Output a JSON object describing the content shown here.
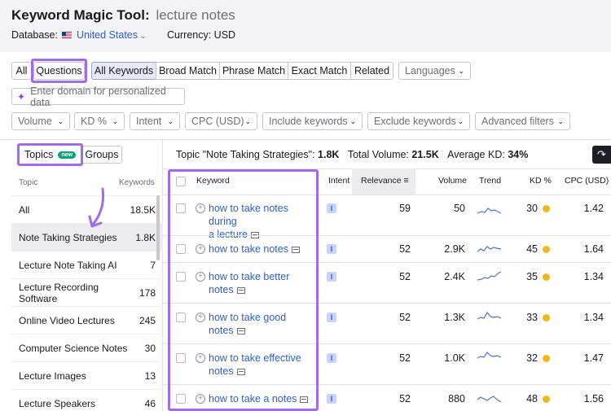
{
  "header": {
    "title": "Keyword Magic Tool:",
    "query": "lecture notes"
  },
  "database": {
    "label": "Database:",
    "country": "United States",
    "currency_label": "Currency: USD"
  },
  "match_tabs": [
    "All",
    "Questions",
    "All Keywords",
    "Broad Match",
    "Phrase Match",
    "Exact Match",
    "Related"
  ],
  "languages": "Languages",
  "domain_placeholder": "Enter domain for personalized data",
  "filters": [
    "Volume",
    "KD %",
    "Intent",
    "CPC (USD)",
    "Include keywords",
    "Exclude keywords",
    "Advanced filters"
  ],
  "side_tabs": {
    "topics": "Topics",
    "badge": "new",
    "groups": "Groups"
  },
  "topics_header": {
    "topic": "Topic",
    "keywords": "Keywords"
  },
  "topics": [
    {
      "name": "All",
      "count": "18.5K"
    },
    {
      "name": "Note Taking Strategies",
      "count": "1.8K"
    },
    {
      "name": "Lecture Note Taking AI",
      "count": "7"
    },
    {
      "name": "Lecture Recording Software",
      "count": "178"
    },
    {
      "name": "Online Video Lectures",
      "count": "245"
    },
    {
      "name": "Computer Science Notes",
      "count": "30"
    },
    {
      "name": "Lecture Images",
      "count": "13"
    },
    {
      "name": "Lecture Speakers",
      "count": "46"
    }
  ],
  "summary": {
    "topic_label": "Topic \"Note Taking Strategies\":",
    "topic_val": "1.8K",
    "vol_label": "Total Volume:",
    "vol_val": "21.5K",
    "kd_label": "Average KD:",
    "kd_val": "34%"
  },
  "table_headers": {
    "keyword": "Keyword",
    "intent": "Intent",
    "relevance": "Relevance",
    "volume": "Volume",
    "trend": "Trend",
    "kd": "KD %",
    "cpc": "CPC (USD)"
  },
  "rows": [
    {
      "kw1": "how to take notes during",
      "kw2": "a lecture",
      "intent": "I",
      "relevance": "59",
      "volume": "50",
      "kd": "30",
      "cpc": "1.42"
    },
    {
      "kw1": "how to take notes",
      "kw2": "",
      "intent": "I",
      "relevance": "52",
      "volume": "2.9K",
      "kd": "45",
      "cpc": "1.64"
    },
    {
      "kw1": "how to take better",
      "kw2": "notes",
      "intent": "I",
      "relevance": "52",
      "volume": "2.4K",
      "kd": "35",
      "cpc": "1.34"
    },
    {
      "kw1": "how to take good",
      "kw2": "notes",
      "intent": "I",
      "relevance": "52",
      "volume": "1.3K",
      "kd": "33",
      "cpc": "1.34"
    },
    {
      "kw1": "how to take effective",
      "kw2": "notes",
      "intent": "I",
      "relevance": "52",
      "volume": "1.0K",
      "kd": "32",
      "cpc": "1.47"
    },
    {
      "kw1": "how to take a notes",
      "kw2": "",
      "intent": "I",
      "relevance": "52",
      "volume": "880",
      "kd": "48",
      "cpc": "1.56"
    }
  ],
  "colors": {
    "accent": "#a26bef",
    "link": "#2d5fcb",
    "kd_dot": "#f2b61d"
  }
}
